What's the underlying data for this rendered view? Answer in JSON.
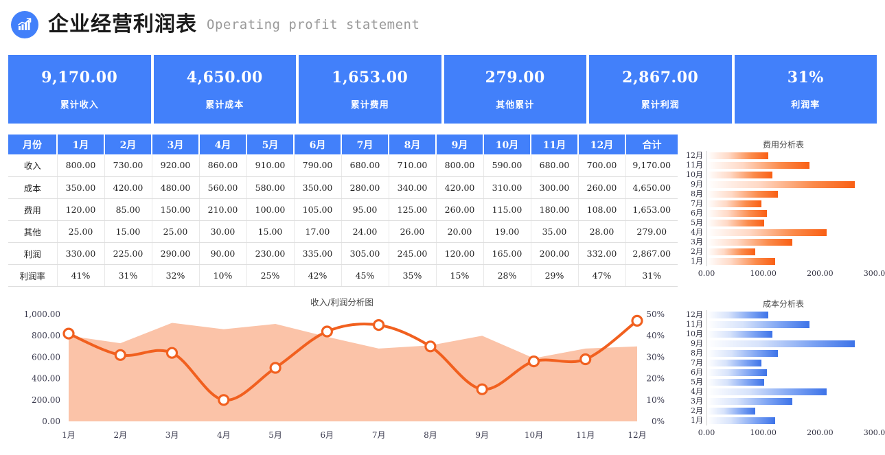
{
  "header": {
    "logo_icon": "bar-chart-growth-icon",
    "title_cn": "企业经营利润表",
    "title_en": "Operating profit statement",
    "accent_color": "#4280fa"
  },
  "kpis": [
    {
      "value": "9,170.00",
      "label": "累计收入"
    },
    {
      "value": "4,650.00",
      "label": "累计成本"
    },
    {
      "value": "1,653.00",
      "label": "累计费用"
    },
    {
      "value": "279.00",
      "label": "其他累计"
    },
    {
      "value": "2,867.00",
      "label": "累计利润"
    },
    {
      "value": "31%",
      "label": "利润率"
    }
  ],
  "table": {
    "headers": [
      "月份",
      "1月",
      "2月",
      "3月",
      "4月",
      "5月",
      "6月",
      "7月",
      "8月",
      "9月",
      "10月",
      "11月",
      "12月",
      "合计"
    ],
    "rows": [
      {
        "label": "收入",
        "cells": [
          "800.00",
          "730.00",
          "920.00",
          "860.00",
          "910.00",
          "790.00",
          "680.00",
          "710.00",
          "800.00",
          "590.00",
          "680.00",
          "700.00",
          "9,170.00"
        ]
      },
      {
        "label": "成本",
        "cells": [
          "350.00",
          "420.00",
          "480.00",
          "560.00",
          "580.00",
          "350.00",
          "280.00",
          "340.00",
          "420.00",
          "310.00",
          "300.00",
          "260.00",
          "4,650.00"
        ]
      },
      {
        "label": "费用",
        "cells": [
          "120.00",
          "85.00",
          "150.00",
          "210.00",
          "100.00",
          "105.00",
          "95.00",
          "125.00",
          "260.00",
          "115.00",
          "180.00",
          "108.00",
          "1,653.00"
        ]
      },
      {
        "label": "其他",
        "cells": [
          "25.00",
          "15.00",
          "25.00",
          "30.00",
          "15.00",
          "17.00",
          "24.00",
          "26.00",
          "20.00",
          "19.00",
          "35.00",
          "28.00",
          "279.00"
        ]
      },
      {
        "label": "利润",
        "cells": [
          "330.00",
          "225.00",
          "290.00",
          "90.00",
          "230.00",
          "335.00",
          "305.00",
          "245.00",
          "120.00",
          "165.00",
          "200.00",
          "332.00",
          "2,867.00"
        ]
      },
      {
        "label": "利润率",
        "cells": [
          "41%",
          "31%",
          "32%",
          "10%",
          "25%",
          "42%",
          "45%",
          "35%",
          "15%",
          "28%",
          "29%",
          "47%",
          "31%"
        ]
      }
    ]
  },
  "chart_data": [
    {
      "id": "revenue_profit_chart",
      "type": "area",
      "title": "收入/利润分析图",
      "xlabel": "",
      "ylabel": "",
      "categories": [
        "1月",
        "2月",
        "3月",
        "4月",
        "5月",
        "6月",
        "7月",
        "8月",
        "9月",
        "10月",
        "11月",
        "12月"
      ],
      "grid": false,
      "legend": "none",
      "axis_left": {
        "ticks": [
          "0.00",
          "200.00",
          "400.00",
          "600.00",
          "800.00",
          "1,000.00"
        ],
        "ylim": [
          0,
          1000
        ]
      },
      "axis_right": {
        "ticks": [
          "0%",
          "10%",
          "20%",
          "30%",
          "40%",
          "50%"
        ],
        "ylim": [
          0,
          50
        ]
      },
      "series": [
        {
          "name": "收入",
          "render": "area",
          "axis": "left",
          "color": "#fbc3a8",
          "values": [
            800,
            730,
            920,
            860,
            910,
            790,
            680,
            710,
            800,
            590,
            680,
            700
          ]
        },
        {
          "name": "利润率",
          "render": "line-markers",
          "axis": "right",
          "color": "#f1601f",
          "values": [
            41,
            31,
            32,
            10,
            25,
            42,
            45,
            35,
            15,
            28,
            29,
            47
          ]
        }
      ]
    },
    {
      "id": "expense_chart",
      "type": "bar",
      "orientation": "horizontal",
      "title": "费用分析表",
      "xlabel": "",
      "ylabel": "",
      "grid": false,
      "legend": "none",
      "color": "#f95f14",
      "xlim": [
        0,
        300
      ],
      "xticks": [
        "0.00",
        "100.00",
        "200.00",
        "300.00"
      ],
      "categories": [
        "12月",
        "11月",
        "10月",
        "9月",
        "8月",
        "7月",
        "6月",
        "5月",
        "4月",
        "3月",
        "2月",
        "1月"
      ],
      "values": [
        108,
        180,
        115,
        260,
        125,
        95,
        105,
        100,
        210,
        150,
        85,
        120
      ]
    },
    {
      "id": "cost_chart",
      "type": "bar",
      "orientation": "horizontal",
      "title": "成本分析表",
      "xlabel": "",
      "ylabel": "",
      "grid": false,
      "legend": "none",
      "color": "#3d73e8",
      "xlim": [
        0,
        300
      ],
      "xticks": [
        "0.00",
        "100.00",
        "200.00",
        "300.00"
      ],
      "categories": [
        "12月",
        "11月",
        "10月",
        "9月",
        "8月",
        "7月",
        "6月",
        "5月",
        "4月",
        "3月",
        "2月",
        "1月"
      ],
      "values": [
        108,
        180,
        115,
        260,
        125,
        95,
        105,
        100,
        210,
        150,
        85,
        120
      ]
    }
  ]
}
